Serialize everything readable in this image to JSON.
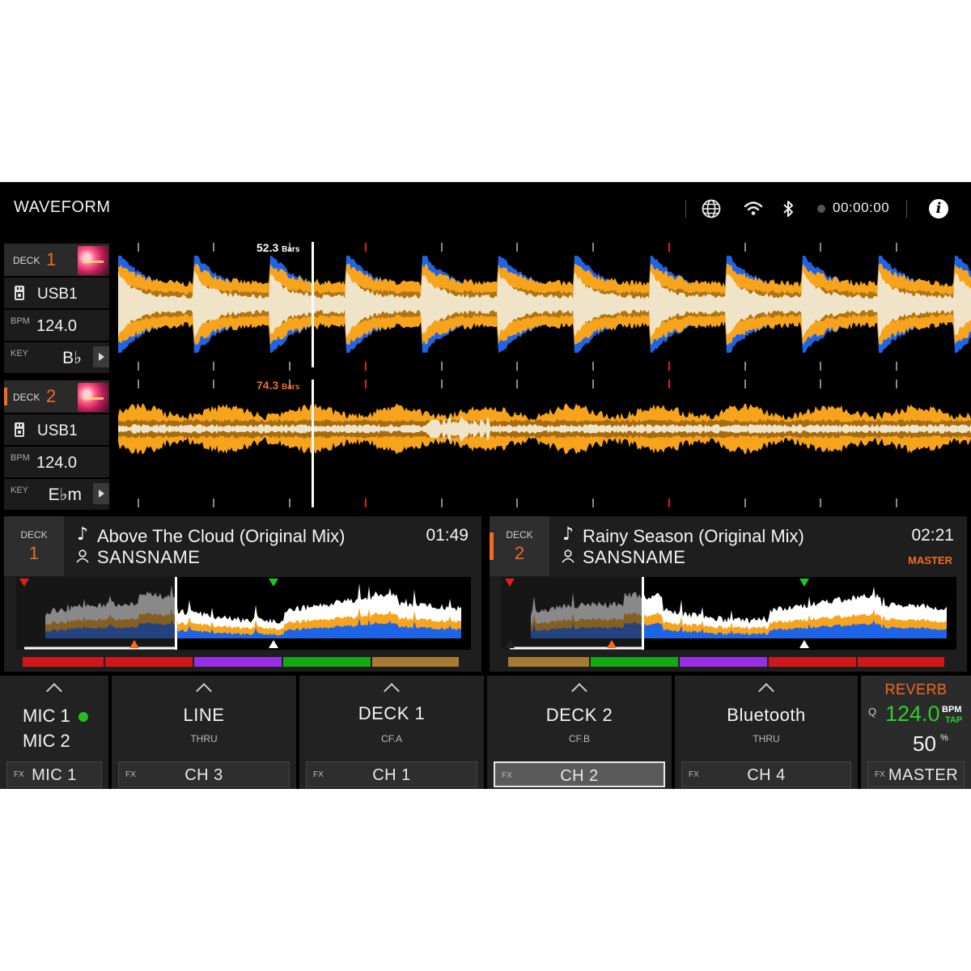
{
  "header": {
    "title": "WAVEFORM",
    "icons": [
      "globe-icon",
      "wifi-icon",
      "bluetooth-icon",
      "info-icon"
    ],
    "clock": "00:00:00"
  },
  "decks": [
    {
      "label": "DECK",
      "number": "1",
      "source": "USB1",
      "bpm_label": "BPM",
      "bpm": "124.0",
      "key_label": "KEY",
      "key": "B♭",
      "bars": "52.3",
      "bars_unit": "Bars"
    },
    {
      "label": "DECK",
      "number": "2",
      "source": "USB1",
      "bpm_label": "BPM",
      "bpm": "124.0",
      "key_label": "KEY",
      "key": "E♭m",
      "bars": "74.3",
      "bars_unit": "Bars"
    }
  ],
  "tracks": [
    {
      "deck_label": "DECK",
      "deck_number": "1",
      "title": "Above The Cloud (Original Mix)",
      "artist": "SANSNAME",
      "time": "01:49",
      "master": ""
    },
    {
      "deck_label": "DECK",
      "deck_number": "2",
      "title": "Rainy Season (Original Mix)",
      "artist": "SANSNAME",
      "time": "02:21",
      "master": "MASTER"
    }
  ],
  "channels": [
    {
      "name_1": "MIC 1",
      "name_2": "MIC 2",
      "fx_label": "FX",
      "fx_value": "MIC 1",
      "mic1_active": true
    },
    {
      "name": "LINE",
      "sub": "THRU",
      "fx_label": "FX",
      "fx_value": "CH 3"
    },
    {
      "name": "DECK 1",
      "sub": "CF.A",
      "fx_label": "FX",
      "fx_value": "CH 1"
    },
    {
      "name": "DECK 2",
      "sub": "CF.B",
      "fx_label": "FX",
      "fx_value": "CH 2",
      "selected": true
    },
    {
      "name": "Bluetooth",
      "sub": "THRU",
      "fx_label": "FX",
      "fx_value": "CH 4"
    }
  ],
  "fx": {
    "effect": "REVERB",
    "q_label": "Q",
    "bpm": "124.0",
    "bpm_label": "BPM",
    "tap_label": "TAP",
    "level": "50",
    "level_unit": "%",
    "fx_label": "FX",
    "target": "MASTER"
  },
  "colors": {
    "accent": "#f26b21",
    "wave_orange": "#f7a31c",
    "wave_blue": "#1e64e6",
    "wave_cream": "#f0e4c8",
    "green": "#2bd12b"
  },
  "overview_1": {
    "played_fraction": 0.35
  },
  "overview_2": {
    "played_fraction": 0.31
  }
}
